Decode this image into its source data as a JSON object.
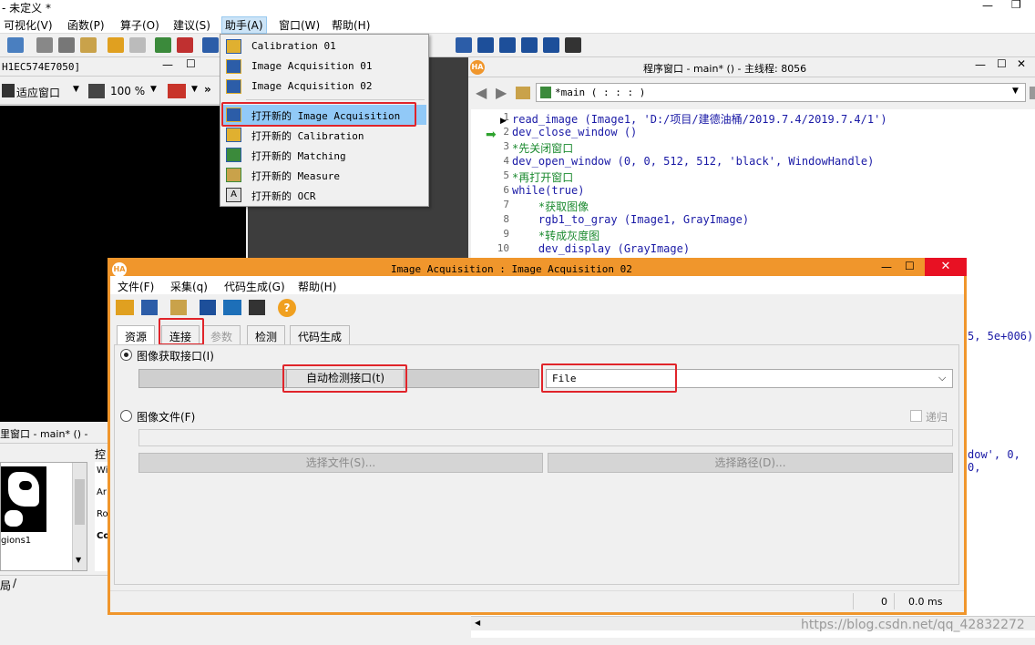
{
  "window": {
    "title": "- 未定义 *"
  },
  "menubar": {
    "items": [
      "可视化(V)",
      "函数(P)",
      "算子(O)",
      "建议(S)",
      "助手(A)",
      "窗口(W)",
      "帮助(H)"
    ]
  },
  "helper_menu": {
    "items": [
      "Calibration 01",
      "Image Acquisition 01",
      "Image Acquisition 02",
      "打开新的 Image Acquisition",
      "打开新的 Calibration",
      "打开新的 Matching",
      "打开新的 Measure",
      "打开新的 OCR"
    ]
  },
  "graphics_window": {
    "title": "H1EC574E7050]",
    "fit_label": "适应窗口",
    "zoom": "100 %"
  },
  "program_window": {
    "title": "程序窗口 - main* () - 主线程: 8056",
    "procedure": "*main ( : : : )",
    "lines": [
      {
        "n": "1",
        "text": "read_image (Image1, 'D:/项目/建德油桶/2019.7.4/2019.7.4/1')",
        "color": "#1a1aa6"
      },
      {
        "n": "2",
        "text": "dev_close_window ()",
        "color": "#1a1aa6"
      },
      {
        "n": "3",
        "text": "*先关闭窗口",
        "color": "#1b8a2f"
      },
      {
        "n": "4",
        "text": "dev_open_window (0, 0, 512, 512, 'black', WindowHandle)",
        "color": "#1a1aa6"
      },
      {
        "n": "5",
        "text": "*再打开窗口",
        "color": "#1b8a2f"
      },
      {
        "n": "6",
        "text": "while(true)",
        "color": "#1a1aa6"
      },
      {
        "n": "7",
        "text": "    *获取图像",
        "color": "#1b8a2f"
      },
      {
        "n": "8",
        "text": "    rgb1_to_gray (Image1, GrayImage)",
        "color": "#1a1aa6"
      },
      {
        "n": "9",
        "text": "    *转成灰度图",
        "color": "#1b8a2f"
      },
      {
        "n": "10",
        "text": "    dev_display (GrayImage)",
        "color": "#1a1aa6"
      }
    ],
    "fragment_1": "5, 5e+006)",
    "fragment_2": "dow', 0, 0,"
  },
  "variable_window": {
    "title": "里窗口 - main* () -",
    "tab": "控",
    "region_label": "gions1",
    "items": [
      "Wi",
      "Ar",
      "Ro",
      "Co"
    ],
    "status_tab": "局"
  },
  "dialog": {
    "title": "Image Acquisition : Image Acquisition 02",
    "menu": [
      "文件(F)",
      "采集(q)",
      "代码生成(G)",
      "帮助(H)"
    ],
    "tabs": [
      "资源",
      "连接",
      "参数",
      "检测",
      "代码生成"
    ],
    "radio_interface": "图像获取接口(I)",
    "auto_detect": "自动检测接口(t)",
    "interface_value": "File",
    "radio_file": "图像文件(F)",
    "recursive": "递归",
    "select_file": "选择文件(S)...",
    "select_path": "选择路径(D)...",
    "status_count": "0",
    "status_time": "0.0 ms"
  },
  "watermark": "https://blog.csdn.net/qq_42832272"
}
